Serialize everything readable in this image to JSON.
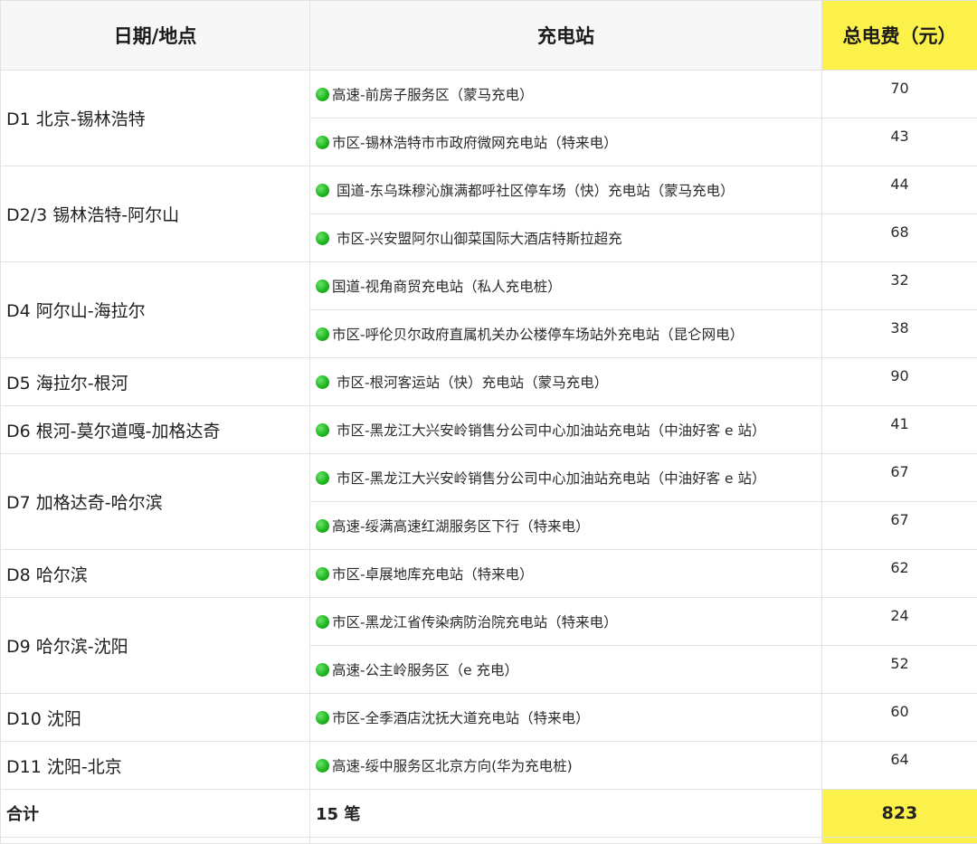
{
  "header": {
    "col_date": "日期/地点",
    "col_station": "充电站",
    "col_fee": "总电费（元）"
  },
  "highlight_color": "#fbf14a",
  "status_dot_color": "#1eb81e",
  "days": [
    {
      "label": "D1 北京-锡林浩特",
      "stations": [
        {
          "name": "高速-前房子服务区（蒙马充电）",
          "fee": "70"
        },
        {
          "name": "市区-锡林浩特市市政府微网充电站（特来电）",
          "fee": "43"
        }
      ]
    },
    {
      "label": "D2/3 锡林浩特-阿尔山",
      "stations": [
        {
          "name": "国道-东乌珠穆沁旗满都呼社区停车场（快）充电站（蒙马充电）",
          "fee": "44",
          "spaced": true
        },
        {
          "name": "市区-兴安盟阿尔山御菜国际大酒店特斯拉超充",
          "fee": "68",
          "spaced": true
        }
      ]
    },
    {
      "label": "D4 阿尔山-海拉尔",
      "stations": [
        {
          "name": "国道-视角商贸充电站（私人充电桩）",
          "fee": "32"
        },
        {
          "name": "市区-呼伦贝尔政府直属机关办公楼停车场站外充电站（昆仑网电）",
          "fee": "38"
        }
      ]
    },
    {
      "label": "D5 海拉尔-根河",
      "stations": [
        {
          "name": "市区-根河客运站（快）充电站（蒙马充电）",
          "fee": "90",
          "spaced": true
        }
      ]
    },
    {
      "label": "D6 根河-莫尔道嘎-加格达奇",
      "stations": [
        {
          "name": "市区-黑龙江大兴安岭销售分公司中心加油站充电站（中油好客 e 站）",
          "fee": "41",
          "spaced": true
        }
      ]
    },
    {
      "label": "D7 加格达奇-哈尔滨",
      "stations": [
        {
          "name": "市区-黑龙江大兴安岭销售分公司中心加油站充电站（中油好客 e 站）",
          "fee": "67",
          "spaced": true
        },
        {
          "name": "高速-绥满高速红湖服务区下行（特来电）",
          "fee": "67"
        }
      ]
    },
    {
      "label": "D8 哈尔滨",
      "stations": [
        {
          "name": "市区-卓展地库充电站（特来电）",
          "fee": "62"
        }
      ]
    },
    {
      "label": "D9 哈尔滨-沈阳",
      "stations": [
        {
          "name": "市区-黑龙江省传染病防治院充电站（特来电）",
          "fee": "24"
        },
        {
          "name": "高速-公主岭服务区（e 充电）",
          "fee": "52"
        }
      ]
    },
    {
      "label": "D10 沈阳",
      "stations": [
        {
          "name": "市区-全季酒店沈抚大道充电站（特来电）",
          "fee": "60"
        }
      ]
    },
    {
      "label": "D11 沈阳-北京",
      "stations": [
        {
          "name": "高速-绥中服务区北京方向(华为充电桩)",
          "fee": "64"
        }
      ]
    }
  ],
  "total": {
    "label": "合计",
    "count": "15 笔",
    "amount": "823"
  }
}
